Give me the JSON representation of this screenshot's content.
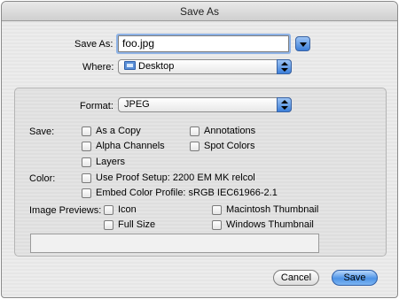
{
  "window": {
    "title": "Save As"
  },
  "save_as": {
    "label": "Save As:",
    "value": "foo.jpg"
  },
  "where": {
    "label": "Where:",
    "value": "Desktop"
  },
  "format": {
    "label": "Format:",
    "value": "JPEG"
  },
  "save_options": {
    "label": "Save:",
    "as_a_copy": {
      "label": "As a Copy",
      "checked": false
    },
    "alpha_channels": {
      "label": "Alpha Channels",
      "checked": false
    },
    "layers": {
      "label": "Layers",
      "checked": false
    },
    "annotations": {
      "label": "Annotations",
      "checked": false
    },
    "spot_colors": {
      "label": "Spot Colors",
      "checked": false
    }
  },
  "color_options": {
    "label": "Color:",
    "use_proof_setup": {
      "label": "Use Proof Setup:  2200 EM MK relcol",
      "checked": false
    },
    "embed_color_profile": {
      "label": "Embed Color Profile:  sRGB IEC61966-2.1",
      "checked": false
    }
  },
  "image_previews": {
    "label": "Image Previews:",
    "icon": {
      "label": "Icon",
      "checked": false
    },
    "full_size": {
      "label": "Full Size",
      "checked": false
    },
    "macintosh_thumbnail": {
      "label": "Macintosh Thumbnail",
      "checked": false
    },
    "windows_thumbnail": {
      "label": "Windows Thumbnail",
      "checked": false
    }
  },
  "buttons": {
    "cancel": "Cancel",
    "save": "Save"
  },
  "colors": {
    "accent": "#3c7fd9",
    "focus_ring": "#8fb3e6"
  }
}
